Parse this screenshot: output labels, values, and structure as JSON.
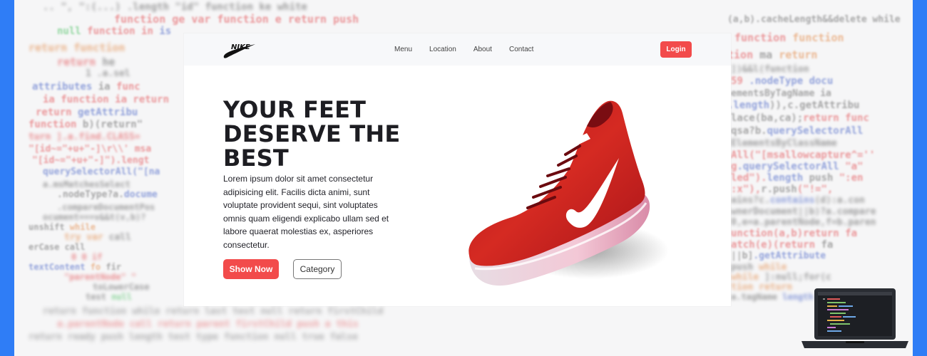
{
  "brand": {
    "logo_text": "NIKE",
    "colors": {
      "accent": "#f24b4b",
      "frame": "#2f7df6",
      "ink": "#1d1d22"
    }
  },
  "navbar": {
    "items": [
      {
        "label": "Menu"
      },
      {
        "label": "Location"
      },
      {
        "label": "About"
      },
      {
        "label": "Contact"
      }
    ],
    "login_label": "Login"
  },
  "hero": {
    "title_lines": [
      "YOUR FEET",
      "DESERVE THE",
      "BEST"
    ],
    "description": "Lorem ipsum dolor sit amet consectetur adipisicing elit. Facilis dicta animi, sunt voluptate provident sequi, sint voluptates omnis quam eligendi explicabo ullam sed et labore quaerat molestias ex, asperiores consectetur.",
    "primary_button": "Show Now",
    "secondary_button": "Category",
    "image": "red-running-shoe"
  },
  "decor": {
    "background": "blurred-code-text",
    "corner_icon": "laptop-icon"
  }
}
